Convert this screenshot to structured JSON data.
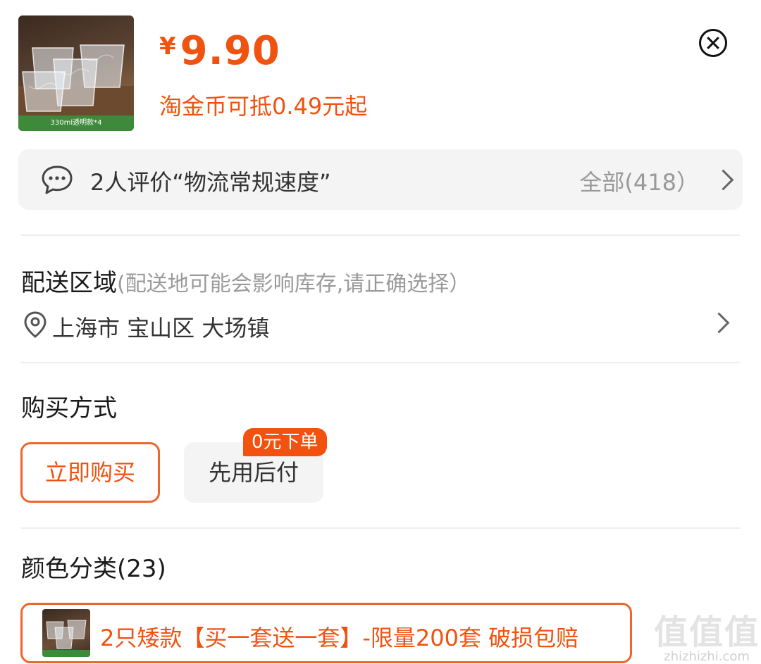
{
  "product": {
    "thumbnail_caption": "330ml透明款*4",
    "currency": "¥",
    "price": "9.90",
    "coin_discount": "淘金币可抵0.49元起"
  },
  "header": {
    "close_icon": "close-circle-icon"
  },
  "reviews": {
    "icon": "chat-bubble-icon",
    "summary": "2人评价“物流常规速度”",
    "all_label": "全部(418）"
  },
  "delivery": {
    "title": "配送区域",
    "hint": "(配送地可能会影响库存,请正确选择）",
    "location_icon": "location-pin-icon",
    "address": "上海市 宝山区 大场镇"
  },
  "purchase": {
    "title": "购买方式",
    "options": [
      {
        "label": "立即购买",
        "selected": true
      },
      {
        "label": "先用后付",
        "selected": false,
        "badge": "0元下单"
      }
    ]
  },
  "variants": {
    "title": "颜色分类(23)",
    "items": [
      {
        "label": "2只矮款【买一套送一套】-限量200套 破损包赔",
        "selected": true
      }
    ]
  },
  "watermark": {
    "logo": "值值值",
    "site": "zhizhizhi.com"
  },
  "colors": {
    "accent": "#f0520f",
    "border_accent": "#f0652c",
    "muted": "#999999"
  }
}
